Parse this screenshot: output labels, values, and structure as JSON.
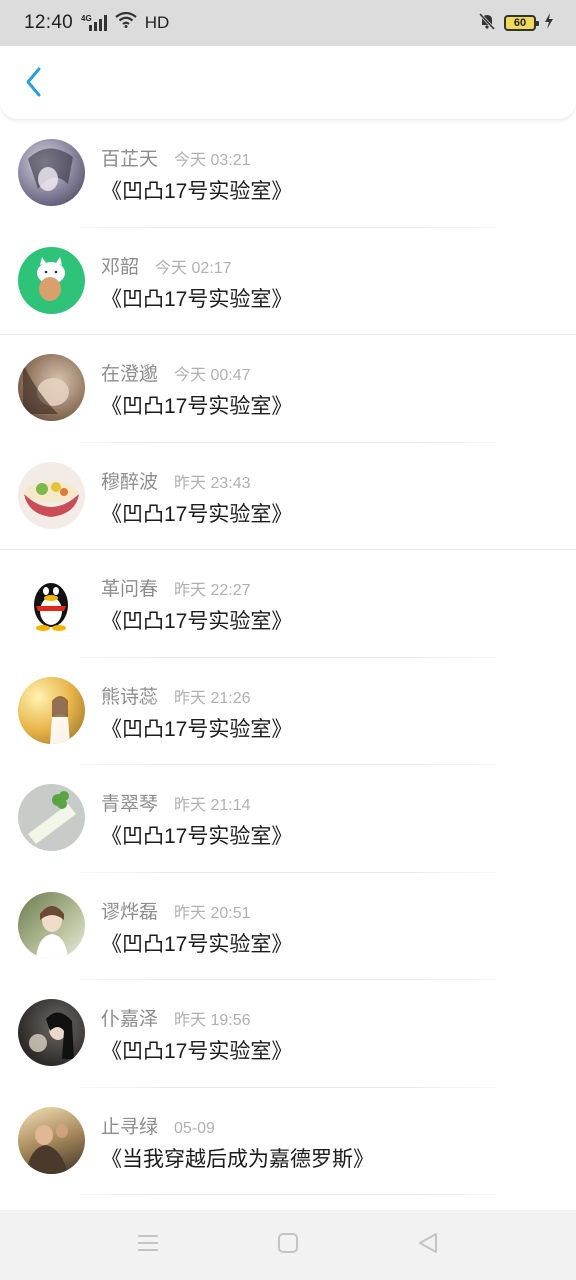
{
  "status_bar": {
    "time": "12:40",
    "network_type": "4G",
    "hd_label": "HD",
    "battery_level": "60",
    "icons": [
      "signal-icon",
      "wifi-icon",
      "mute-icon",
      "battery-icon",
      "charging-icon"
    ]
  },
  "header": {
    "back_icon": "chevron-left-icon",
    "accent_color": "#2a9fe0"
  },
  "items": [
    {
      "name": "百芷天",
      "time": "今天 03:21",
      "title": "《凹凸17号实验室》"
    },
    {
      "name": "邓韶",
      "time": "今天 02:17",
      "title": "《凹凸17号实验室》"
    },
    {
      "name": "在澄邈",
      "time": "今天 00:47",
      "title": "《凹凸17号实验室》"
    },
    {
      "name": "穆醉波",
      "time": "昨天 23:43",
      "title": "《凹凸17号实验室》"
    },
    {
      "name": "革问春",
      "time": "昨天 22:27",
      "title": "《凹凸17号实验室》"
    },
    {
      "name": "熊诗蕊",
      "time": "昨天 21:26",
      "title": "《凹凸17号实验室》"
    },
    {
      "name": "青翠琴",
      "time": "昨天 21:14",
      "title": "《凹凸17号实验室》"
    },
    {
      "name": "谬烨磊",
      "time": "昨天 20:51",
      "title": "《凹凸17号实验室》"
    },
    {
      "name": "仆嘉泽",
      "time": "昨天 19:56",
      "title": "《凹凸17号实验室》"
    },
    {
      "name": "止寻绿",
      "time": "05-09",
      "title": "《当我穿越后成为嘉德罗斯》"
    }
  ],
  "nav_bar": {
    "icons": [
      "menu-icon",
      "home-icon",
      "back-triangle-icon"
    ]
  }
}
